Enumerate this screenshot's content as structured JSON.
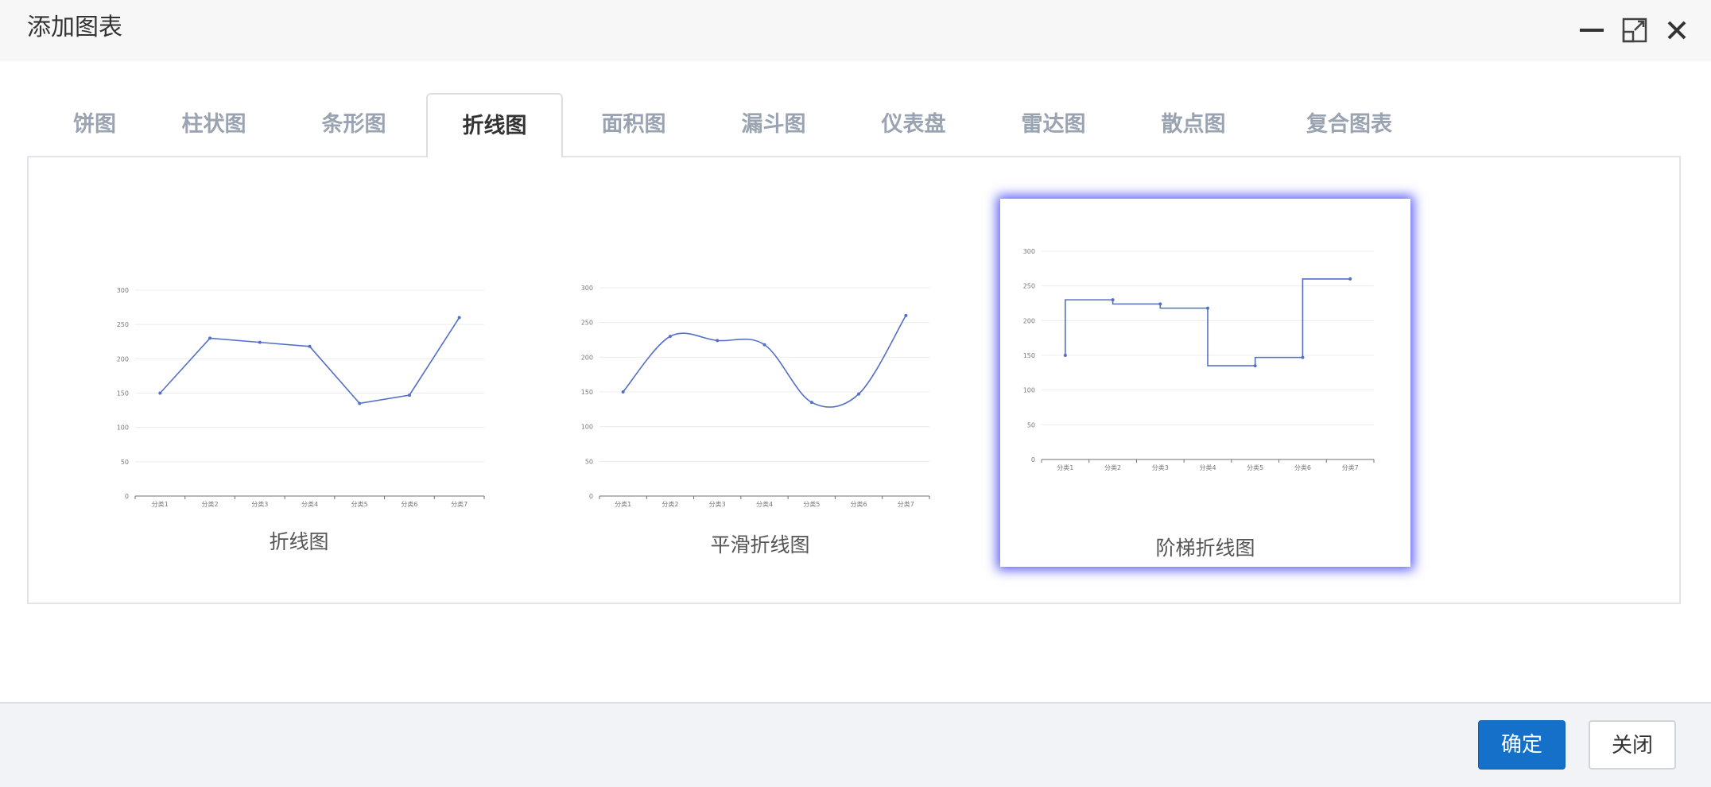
{
  "dialog": {
    "title": "添加图表",
    "minimize_icon": "minimize-icon",
    "maximize_icon": "maximize-icon",
    "close_icon": "close-icon"
  },
  "tabs": [
    {
      "label": "饼图"
    },
    {
      "label": "柱状图"
    },
    {
      "label": "条形图"
    },
    {
      "label": "折线图",
      "active": true
    },
    {
      "label": "面积图"
    },
    {
      "label": "漏斗图"
    },
    {
      "label": "仪表盘"
    },
    {
      "label": "雷达图"
    },
    {
      "label": "散点图"
    },
    {
      "label": "复合图表"
    }
  ],
  "charts": [
    {
      "label": "折线图",
      "style": "straight",
      "selected": false
    },
    {
      "label": "平滑折线图",
      "style": "smooth",
      "selected": false
    },
    {
      "label": "阶梯折线图",
      "style": "step",
      "selected": true
    }
  ],
  "chart_data": {
    "type": "line",
    "categories": [
      "分类1",
      "分类2",
      "分类3",
      "分类4",
      "分类5",
      "分类6",
      "分类7"
    ],
    "series": [
      {
        "values": [
          150,
          230,
          224,
          218,
          135,
          147,
          260
        ]
      }
    ],
    "y_ticks": [
      0,
      50,
      100,
      150,
      200,
      250,
      300
    ],
    "ylim": [
      0,
      300
    ],
    "grid": true,
    "line_color": "#5470c6"
  },
  "footer": {
    "confirm_label": "确定",
    "close_label": "关闭"
  },
  "colors": {
    "accent": "#1470c8",
    "selected_glow": "#5b5cf2"
  }
}
